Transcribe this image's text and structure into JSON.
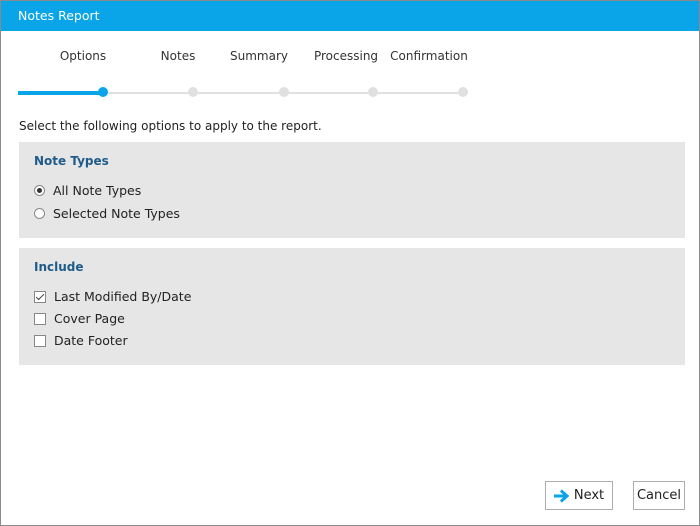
{
  "window": {
    "title": "Notes Report"
  },
  "wizard": {
    "steps": [
      {
        "label": "Options"
      },
      {
        "label": "Notes"
      },
      {
        "label": "Summary"
      },
      {
        "label": "Processing"
      },
      {
        "label": "Confirmation"
      }
    ],
    "current_step": 1,
    "total_steps": 5
  },
  "intro": "Select the following options to apply to the report.",
  "note_types": {
    "title": "Note Types",
    "options": [
      {
        "label": "All Note Types",
        "selected": true
      },
      {
        "label": "Selected Note Types",
        "selected": false
      }
    ]
  },
  "include": {
    "title": "Include",
    "options": [
      {
        "label": "Last Modified By/Date",
        "checked": true
      },
      {
        "label": "Cover Page",
        "checked": false
      },
      {
        "label": "Date Footer",
        "checked": false
      }
    ]
  },
  "buttons": {
    "next": "Next",
    "cancel": "Cancel"
  },
  "colors": {
    "accent": "#0aa5e8",
    "group_bg": "#e6e6e6",
    "group_title": "#1f5b8a"
  },
  "icons": {
    "next": "arrow-right-icon"
  }
}
